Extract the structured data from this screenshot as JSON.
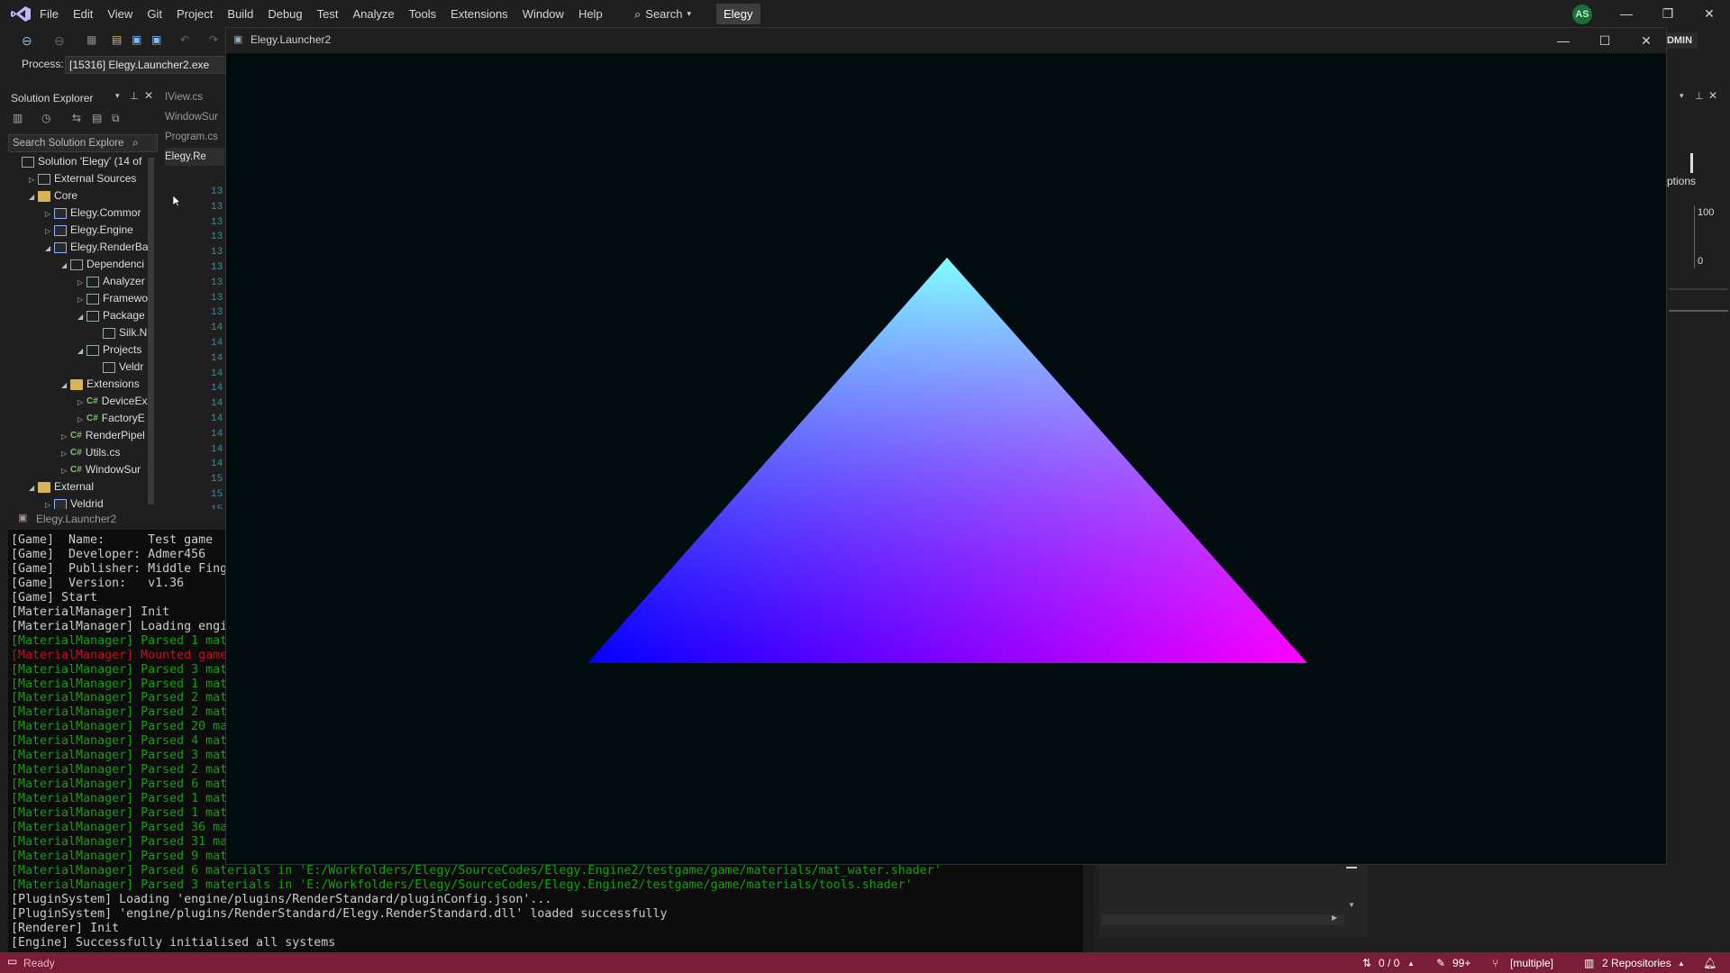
{
  "menubar": {
    "items": [
      "File",
      "Edit",
      "View",
      "Git",
      "Project",
      "Build",
      "Debug",
      "Test",
      "Analyze",
      "Tools",
      "Extensions",
      "Window",
      "Help"
    ],
    "search_label": "Search",
    "solution_name": "Elegy",
    "avatar_initials": "AS"
  },
  "toolbar": {
    "admin_label": "ADMIN"
  },
  "process": {
    "label": "Process:",
    "value": "[15316] Elegy.Launcher2.exe"
  },
  "solution_explorer": {
    "title": "Solution Explorer",
    "search_placeholder": "Search Solution Explore",
    "tree": [
      {
        "label": "Solution 'Elegy' (14 of",
        "indent": 0,
        "arrow": "",
        "icon": "solution"
      },
      {
        "label": "External Sources",
        "indent": 1,
        "arrow": "▷",
        "icon": "ext"
      },
      {
        "label": "Core",
        "indent": 1,
        "arrow": "◢",
        "icon": "folder"
      },
      {
        "label": "Elegy.Commor",
        "indent": 2,
        "arrow": "▷",
        "icon": "proj"
      },
      {
        "label": "Elegy.Engine",
        "indent": 2,
        "arrow": "▷",
        "icon": "proj"
      },
      {
        "label": "Elegy.RenderBa",
        "indent": 2,
        "arrow": "◢",
        "icon": "proj"
      },
      {
        "label": "Dependenci",
        "indent": 3,
        "arrow": "◢",
        "icon": "dep"
      },
      {
        "label": "Analyzer",
        "indent": 4,
        "arrow": "▷",
        "icon": "dep"
      },
      {
        "label": "Framewo",
        "indent": 4,
        "arrow": "▷",
        "icon": "dep"
      },
      {
        "label": "Package",
        "indent": 4,
        "arrow": "◢",
        "icon": "dep"
      },
      {
        "label": "Silk.N",
        "indent": 5,
        "arrow": "",
        "icon": "dep"
      },
      {
        "label": "Projects",
        "indent": 4,
        "arrow": "◢",
        "icon": "dep"
      },
      {
        "label": "Veldr",
        "indent": 5,
        "arrow": "",
        "icon": "dep"
      },
      {
        "label": "Extensions",
        "indent": 3,
        "arrow": "◢",
        "icon": "folder"
      },
      {
        "label": "DeviceEx",
        "indent": 4,
        "arrow": "▷",
        "icon": "cs"
      },
      {
        "label": "FactoryE",
        "indent": 4,
        "arrow": "▷",
        "icon": "cs"
      },
      {
        "label": "RenderPipel",
        "indent": 3,
        "arrow": "▷",
        "icon": "cs"
      },
      {
        "label": "Utils.cs",
        "indent": 3,
        "arrow": "▷",
        "icon": "cs"
      },
      {
        "label": "WindowSur",
        "indent": 3,
        "arrow": "▷",
        "icon": "cs"
      },
      {
        "label": "External",
        "indent": 1,
        "arrow": "◢",
        "icon": "folder"
      },
      {
        "label": "Veldrid",
        "indent": 2,
        "arrow": "▷",
        "icon": "proj"
      }
    ]
  },
  "editor": {
    "tabs": [
      "IView.cs",
      "WindowSur",
      "Program.cs",
      "Elegy.Re"
    ],
    "line_numbers": [
      "13",
      "13",
      "13",
      "13",
      "13",
      "13",
      "13",
      "13",
      "13",
      "14",
      "14",
      "14",
      "14",
      "14",
      "14",
      "14",
      "14",
      "14",
      "14",
      "15",
      "15",
      "15"
    ]
  },
  "console": {
    "title": "Elegy.Launcher2",
    "lines": [
      {
        "text": "[Game]  Name:      Test game",
        "color": "w"
      },
      {
        "text": "[Game]  Developer: Admer456",
        "color": "w"
      },
      {
        "text": "[Game]  Publisher: Middle Fing",
        "color": "w"
      },
      {
        "text": "[Game]  Version:   v1.36",
        "color": "w"
      },
      {
        "text": "[Game] Start",
        "color": "w"
      },
      {
        "text": "[MaterialManager] Init",
        "color": "w"
      },
      {
        "text": "[MaterialManager] Loading engi",
        "color": "w"
      },
      {
        "text": "[MaterialManager] Parsed 1 mat",
        "color": "g"
      },
      {
        "text": "[MaterialManager] Mounted game",
        "color": "r"
      },
      {
        "text": "[MaterialManager] Parsed 3 mat",
        "color": "g"
      },
      {
        "text": "[MaterialManager] Parsed 1 mat",
        "color": "g"
      },
      {
        "text": "[MaterialManager] Parsed 2 mat",
        "color": "g"
      },
      {
        "text": "[MaterialManager] Parsed 2 mat",
        "color": "g"
      },
      {
        "text": "[MaterialManager] Parsed 20 ma",
        "color": "g"
      },
      {
        "text": "[MaterialManager] Parsed 4 mat",
        "color": "g"
      },
      {
        "text": "[MaterialManager] Parsed 3 mat",
        "color": "g"
      },
      {
        "text": "[MaterialManager] Parsed 2 mat",
        "color": "g"
      },
      {
        "text": "[MaterialManager] Parsed 6 mat",
        "color": "g"
      },
      {
        "text": "[MaterialManager] Parsed 1 mat",
        "color": "g"
      },
      {
        "text": "[MaterialManager] Parsed 1 mat",
        "color": "g"
      },
      {
        "text": "[MaterialManager] Parsed 36 ma",
        "color": "g"
      },
      {
        "text": "[MaterialManager] Parsed 31 ma",
        "color": "g"
      },
      {
        "text": "[MaterialManager] Parsed 9 mat",
        "color": "g"
      },
      {
        "text": "[MaterialManager] Parsed 6 materials in 'E:/Workfolders/Elegy/SourceCodes/Elegy.Engine2/testgame/game/materials/mat_water.shader'",
        "color": "g"
      },
      {
        "text": "[MaterialManager] Parsed 3 materials in 'E:/Workfolders/Elegy/SourceCodes/Elegy.Engine2/testgame/game/materials/tools.shader'",
        "color": "g"
      },
      {
        "text": "[PluginSystem] Loading 'engine/plugins/RenderStandard/pluginConfig.json'...",
        "color": "w"
      },
      {
        "text": "[PluginSystem] 'engine/plugins/RenderStandard/Elegy.RenderStandard.dll' loaded successfully",
        "color": "w"
      },
      {
        "text": "[Renderer] Init",
        "color": "w"
      },
      {
        "text": "[Engine] Successfully initialised all systems",
        "color": "w"
      }
    ]
  },
  "game_window": {
    "title": "Elegy.Launcher2",
    "colors": {
      "background": "#020c0e",
      "top": "#80ffff",
      "left": "#0000ff",
      "right": "#ff00ff"
    }
  },
  "right_panel": {
    "options_label": "ptions",
    "value_top": "100",
    "value_bottom": "0"
  },
  "statusbar": {
    "ready": "Ready",
    "changes": "0 / 0",
    "edits": "99+",
    "branch": "[multiple]",
    "repos": "2 Repositories"
  }
}
